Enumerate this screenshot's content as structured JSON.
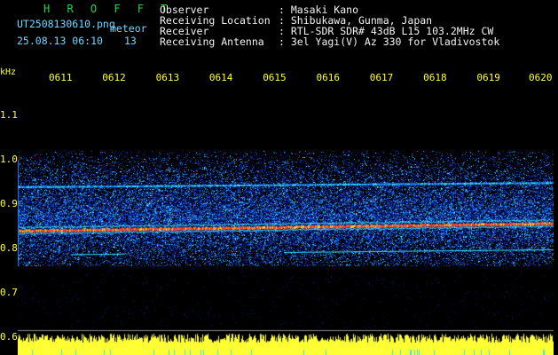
{
  "header": {
    "title": "H R O F F T",
    "filename": "UT2508130610.png",
    "type_label": "meteor",
    "datetime": "25.08.13 06:10",
    "count": "13"
  },
  "info": {
    "observer_label": "Observer",
    "observer_value": ": Masaki Kano",
    "location_label": "Receiving Location",
    "location_value": ": Shibukawa, Gunma, Japan",
    "receiver_label": "Receiver",
    "receiver_value": ": RTL-SDR SDR# 43dB L15 103.2MHz CW",
    "antenna_label": "Receiving Antenna",
    "antenna_value": ": 3el Yagi(V) Az 330 for Vladivostok"
  },
  "axis": {
    "unit": "kHz",
    "x_ticks": [
      "0611",
      "0612",
      "0613",
      "0614",
      "0615",
      "0616",
      "0617",
      "0618",
      "0619",
      "0620"
    ],
    "y_ticks": [
      "1.1",
      "1.0",
      "0.9",
      "0.8",
      "0.7",
      "0.6"
    ]
  },
  "colors": {
    "background": "#000000",
    "title": "#22d63a",
    "meta": "#6fd8ff",
    "info": "#f2f2f2",
    "axis": "#ffff33",
    "noise_low": "#0a1f9a",
    "noise_mid": "#1e7dff",
    "signal_hot": "#ff3b2f",
    "signal_warm": "#ffe033",
    "signal_cyan": "#33e6ff"
  }
}
